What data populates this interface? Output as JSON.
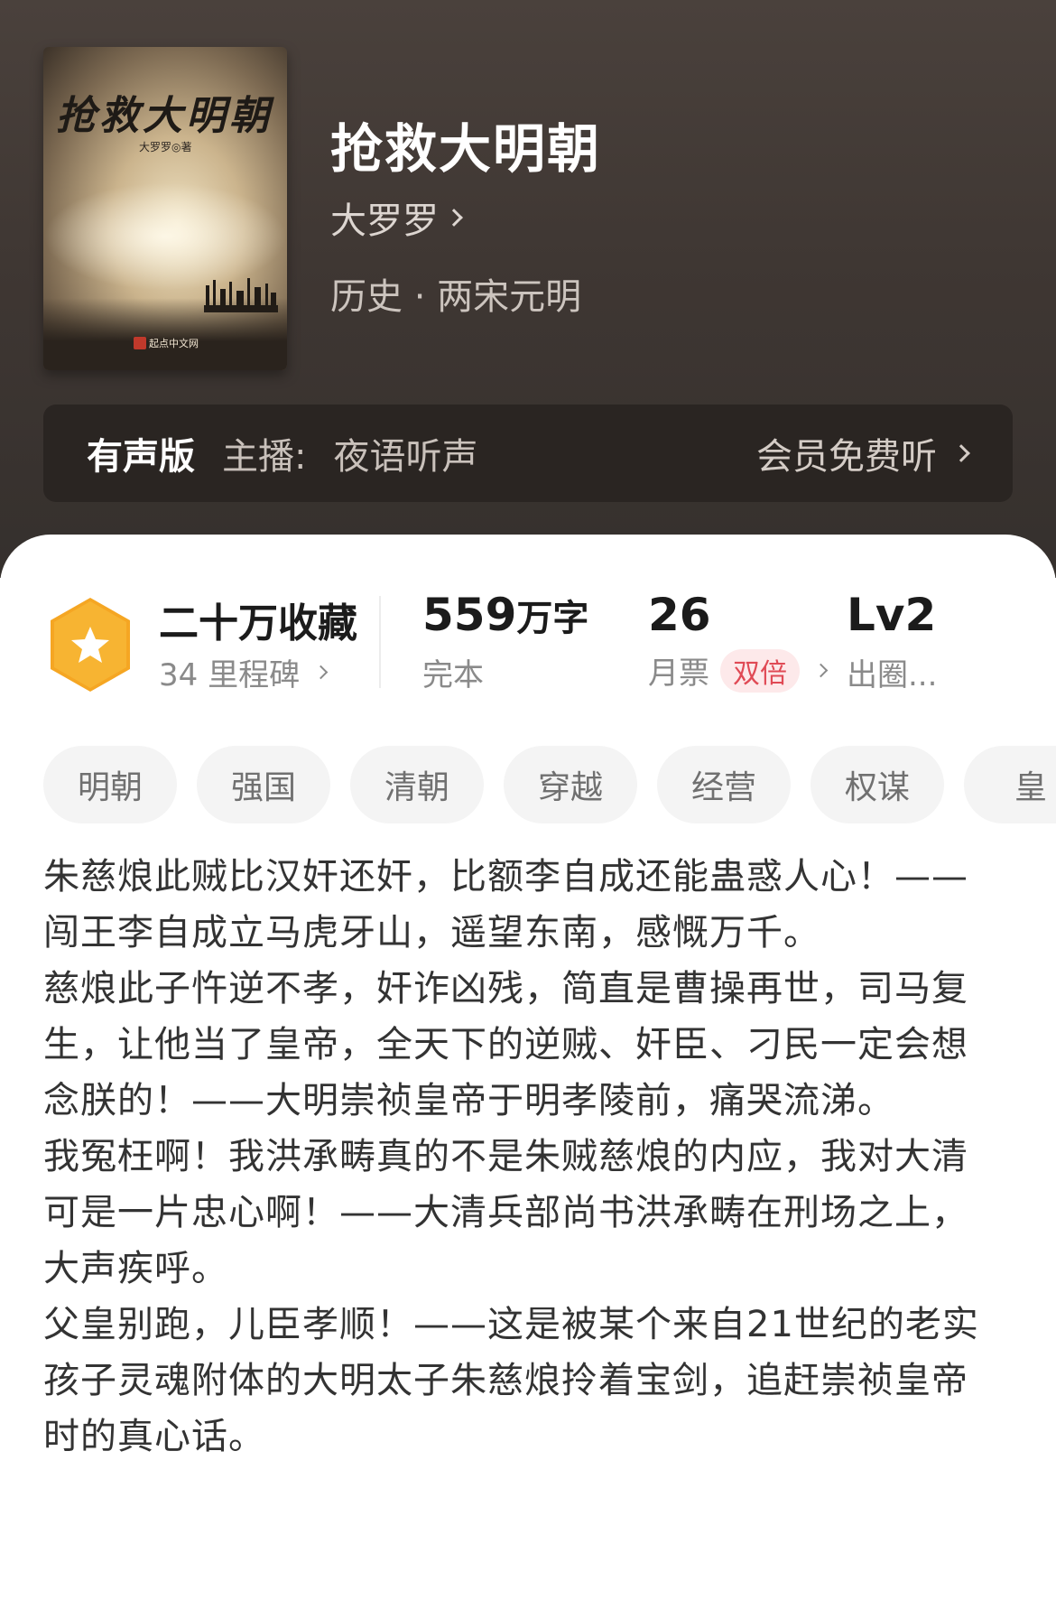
{
  "book": {
    "cover_title": "抢救大明朝",
    "cover_author": "大罗罗◎著",
    "cover_publisher": "起点中文网",
    "title": "抢救大明朝",
    "author": "大罗罗",
    "category": "历史 · 两宋元明"
  },
  "audio": {
    "label": "有声版",
    "host_label": "主播:",
    "host": "夜语听声",
    "cta": "会员免费听"
  },
  "stats": {
    "collections": "二十万收藏",
    "milestones": "34 里程碑",
    "word_count": "559",
    "word_unit": "万字",
    "status": "完本",
    "monthly_votes": "26",
    "monthly_votes_label": "月票",
    "double_badge": "双倍",
    "level": "Lv2",
    "level_sub": "出圈..."
  },
  "tags": [
    "明朝",
    "强国",
    "清朝",
    "穿越",
    "经营",
    "权谋",
    "皇"
  ],
  "synopsis": [
    "朱慈烺此贼比汉奸还奸，比额李自成还能蛊惑人心！——闯王李自成立马虎牙山，遥望东南，感慨万千。",
    "慈烺此子忤逆不孝，奸诈凶残，简直是曹操再世，司马复生，让他当了皇帝，全天下的逆贼、奸臣、刁民一定会想念朕的！——大明崇祯皇帝于明孝陵前，痛哭流涕。",
    "我冤枉啊！我洪承畴真的不是朱贼慈烺的内应，我对大清可是一片忠心啊！——大清兵部尚书洪承畴在刑场之上，大声疾呼。",
    "父皇别跑，儿臣孝顺！——这是被某个来自21世纪的老实孩子灵魂附体的大明太子朱慈烺拎着宝剑，追赶崇祯皇帝时的真心话。"
  ],
  "colors": {
    "header_bg": "#3f3733",
    "badge_orange": "#f5a623",
    "double_red": "#e04a55"
  }
}
